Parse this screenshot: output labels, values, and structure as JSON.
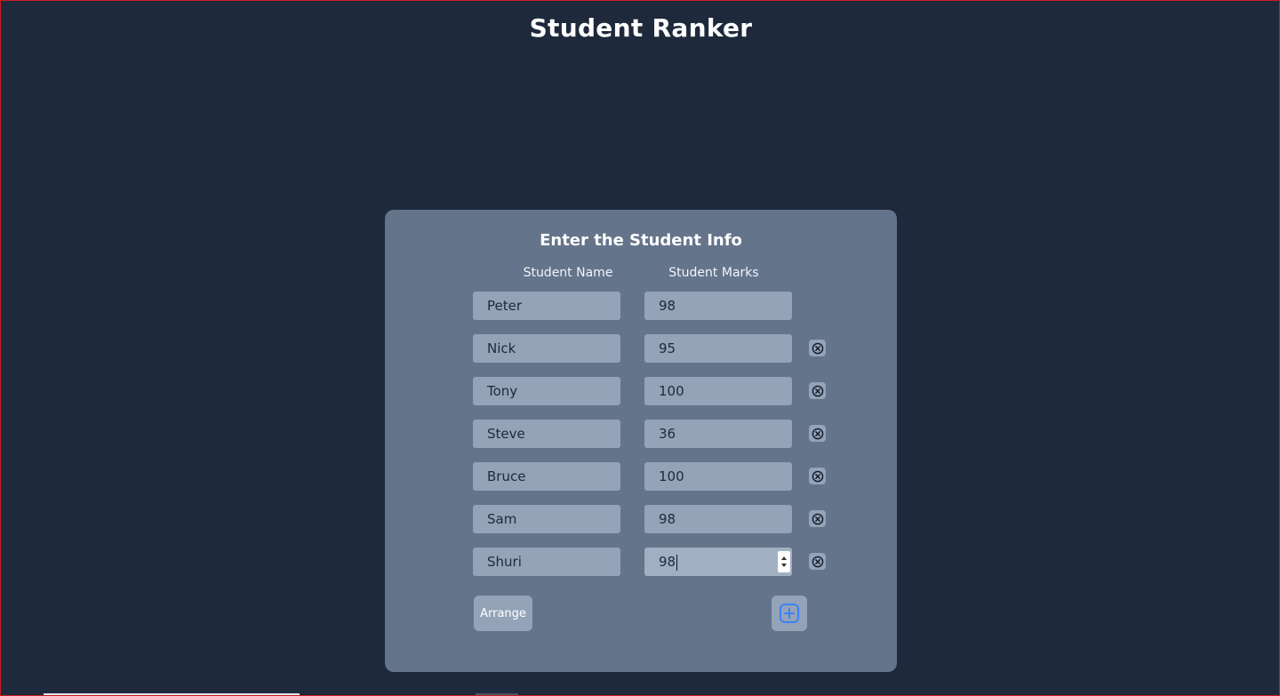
{
  "app": {
    "title": "Student Ranker"
  },
  "form": {
    "title": "Enter the Student Info",
    "headers": {
      "name": "Student Name",
      "marks": "Student Marks"
    },
    "students": [
      {
        "name": "Peter",
        "marks": "98",
        "removable": false
      },
      {
        "name": "Nick",
        "marks": "95",
        "removable": true
      },
      {
        "name": "Tony",
        "marks": "100",
        "removable": true
      },
      {
        "name": "Steve",
        "marks": "36",
        "removable": true
      },
      {
        "name": "Bruce",
        "marks": "100",
        "removable": true
      },
      {
        "name": "Sam",
        "marks": "98",
        "removable": true
      },
      {
        "name": "Shuri",
        "marks": "98",
        "removable": true,
        "focused": true
      }
    ],
    "arrange_label": "Arrange"
  },
  "colors": {
    "background": "#1e293b",
    "card": "#64748b",
    "field": "#94a3b8",
    "add_icon": "#3b82f6"
  },
  "icons": {
    "remove": "circle-x-icon",
    "add": "square-plus-icon"
  }
}
